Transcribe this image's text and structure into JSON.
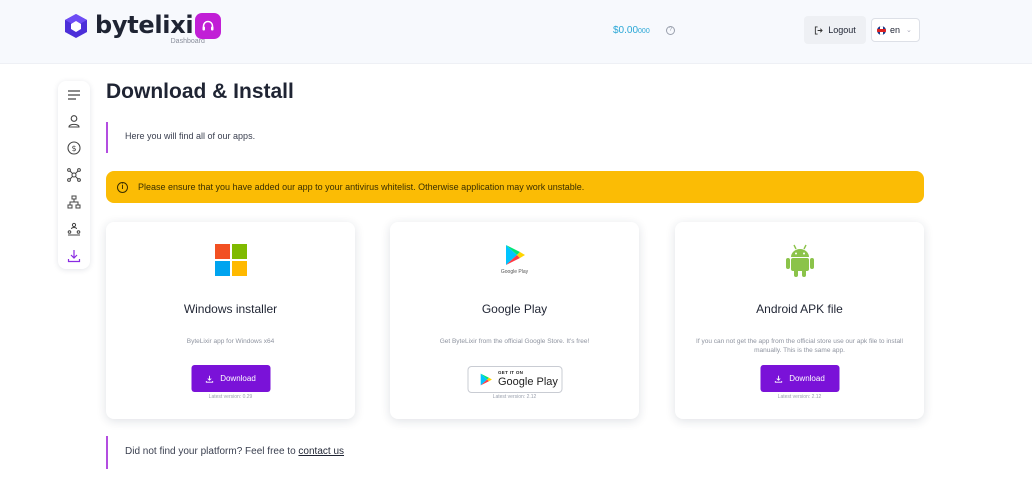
{
  "header": {
    "brand": "bytelixir",
    "brand_sub": "Dashboard",
    "balance_main": "$0.00",
    "balance_small": "000",
    "logout_label": "Logout",
    "language": "en",
    "colors": {
      "accent": "#c11fd6",
      "balance": "#2aa7d6"
    }
  },
  "sidebar": {
    "items": [
      {
        "icon": "menu-icon"
      },
      {
        "icon": "user-icon"
      },
      {
        "icon": "dollar-icon"
      },
      {
        "icon": "network-icon"
      },
      {
        "icon": "hierarchy-icon"
      },
      {
        "icon": "referral-icon"
      },
      {
        "icon": "download-icon",
        "active": true
      }
    ]
  },
  "main": {
    "title": "Download & Install",
    "intro": "Here you will find all of our apps.",
    "alert": "Please ensure that you have added our app to your antivirus whitelist. Otherwise application may work unstable.",
    "alert_color": "#fbbc05",
    "cards": [
      {
        "title": "Windows installer",
        "desc": "ByteLixir app for Windows x64",
        "button": "Download",
        "version": "Latest version: 0.29"
      },
      {
        "title": "Google Play",
        "icon_caption": "Google Play",
        "desc": "Get ByteLixir from the official Google Store. It's free!",
        "badge_small": "GET IT ON",
        "badge_big": "Google Play",
        "version": "Latest version: 2.12"
      },
      {
        "title": "Android APK file",
        "desc": "If you can not get the app from the official store use our apk file to install manually. This is the same app.",
        "button": "Download",
        "version": "Latest version: 2.12"
      }
    ],
    "footer_text": "Did not find your platform? Feel free to ",
    "footer_link": "contact us"
  }
}
